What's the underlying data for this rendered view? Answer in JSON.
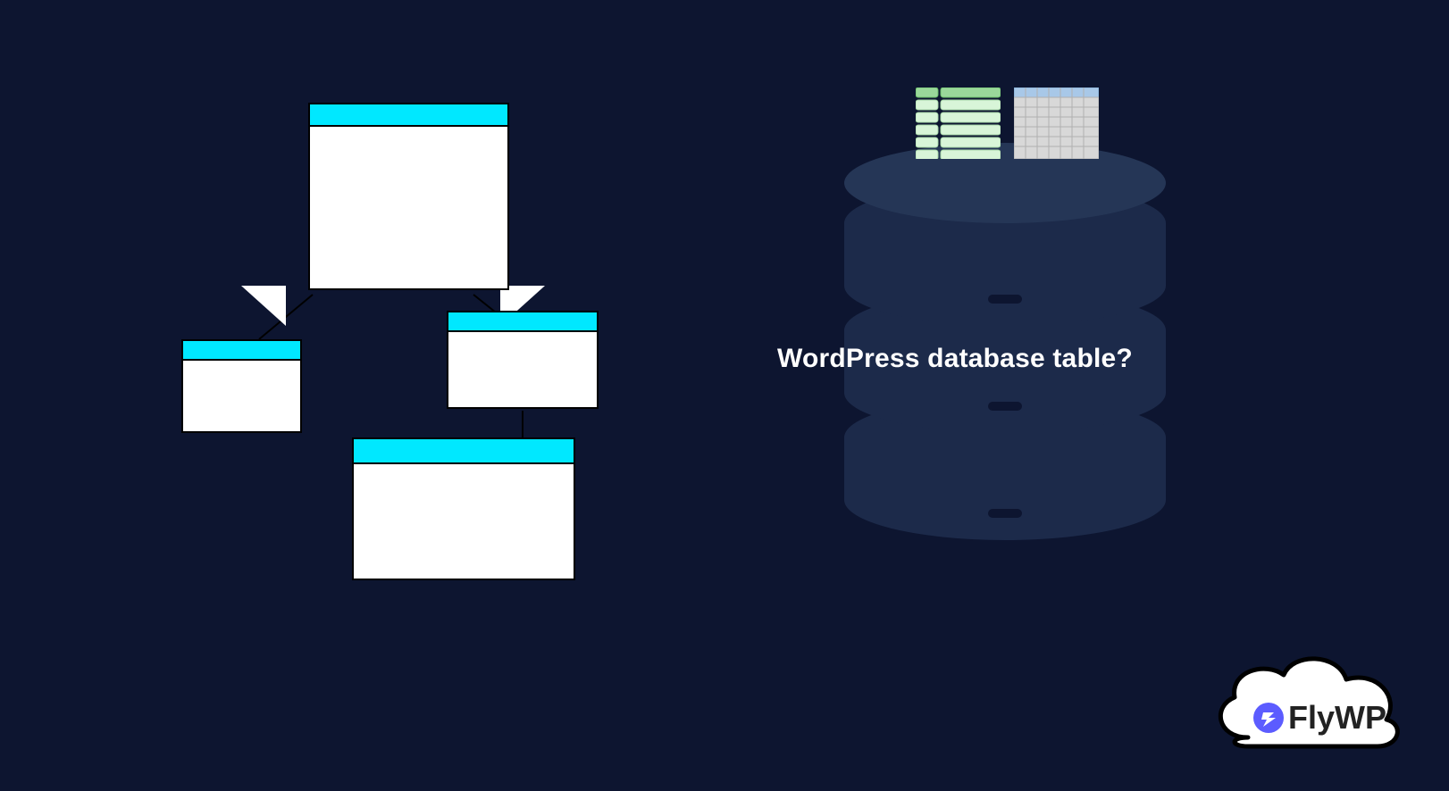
{
  "heading": "WordPress database table?",
  "logo": {
    "name": "FlyWP"
  },
  "colors": {
    "background": "#0d1530",
    "table_header": "#00e8ff",
    "db_disc": "#1c2a4a",
    "db_top": "#253656",
    "green_table": "#c8f0c8",
    "blue_table": "#b8d4f0",
    "logo_accent": "#5c5cff"
  },
  "diagram": {
    "elements": [
      {
        "type": "schema-table",
        "id": "main",
        "role": "parent"
      },
      {
        "type": "schema-table",
        "id": "left",
        "role": "child"
      },
      {
        "type": "schema-table",
        "id": "right",
        "role": "child"
      },
      {
        "type": "schema-table",
        "id": "bottom",
        "role": "child"
      }
    ],
    "connectors": [
      {
        "from": "main",
        "to": "left"
      },
      {
        "from": "main",
        "to": "right"
      },
      {
        "from": "right",
        "to": "bottom"
      }
    ]
  },
  "icons": [
    {
      "name": "green-list-table",
      "style": "striped-rows"
    },
    {
      "name": "blue-grid-table",
      "style": "grid-cells"
    }
  ]
}
